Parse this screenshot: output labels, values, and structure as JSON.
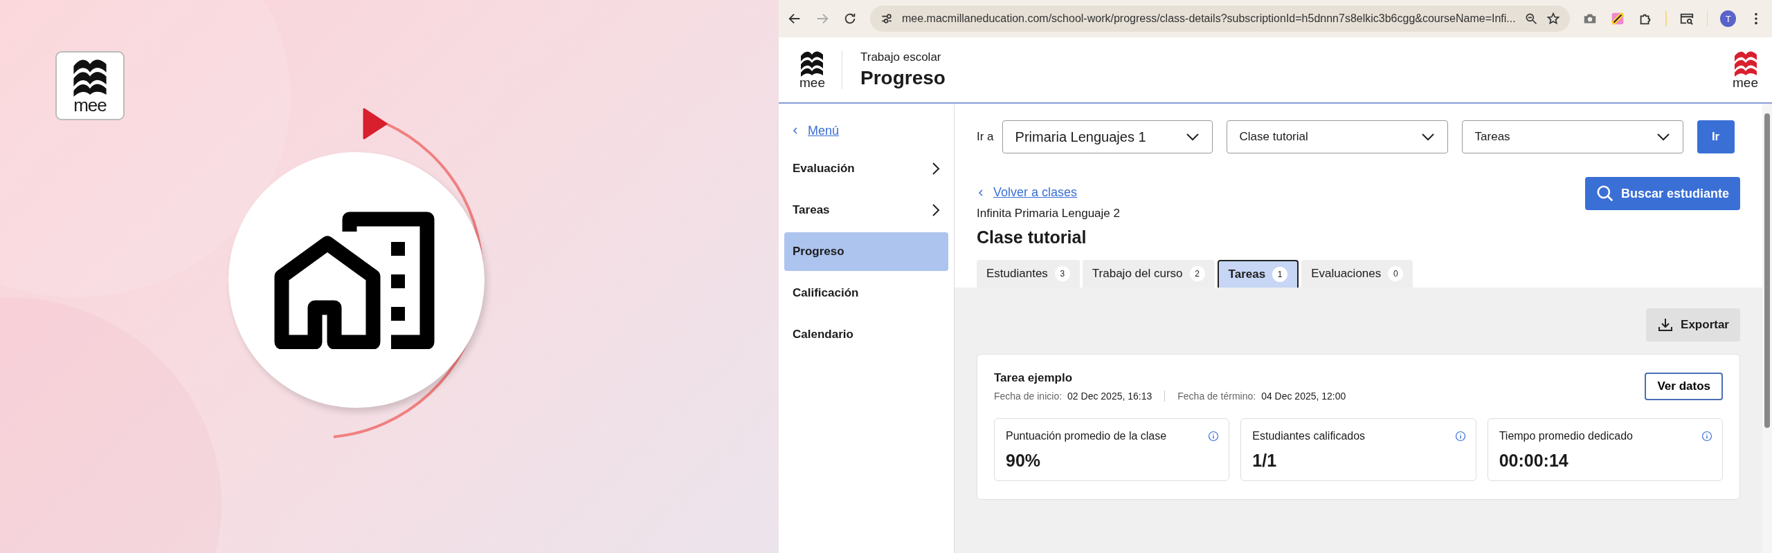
{
  "banner": {
    "logo_text": "mee"
  },
  "browser": {
    "url": "mee.macmillaneducation.com/school-work/progress/class-details?subscriptionId=h5dnnn7s8elkic3b6cgg&courseName=Infi...",
    "avatar": "T"
  },
  "header": {
    "logo_text": "mee",
    "section": "Trabajo escolar",
    "title": "Progreso",
    "brand_logo_text": "mee"
  },
  "sidebar": {
    "back_link": "Menú",
    "items": [
      {
        "label": "Evaluación",
        "kind": "submenu",
        "selected": false
      },
      {
        "label": "Tareas",
        "kind": "submenu",
        "selected": false
      },
      {
        "label": "Progreso",
        "kind": "link",
        "selected": true
      },
      {
        "label": "Calificación",
        "kind": "link",
        "selected": false
      },
      {
        "label": "Calendario",
        "kind": "link",
        "selected": false
      }
    ]
  },
  "navigator": {
    "label": "Ir a",
    "dropdowns": [
      {
        "value": "Primaria Lenguajes 1"
      },
      {
        "value": "Clase tutorial"
      },
      {
        "value": "Tareas"
      }
    ],
    "go_button": "Ir"
  },
  "back_link": "Volver a clases",
  "search_button": "Buscar estudiante",
  "course": "Infinita Primaria Lenguaje 2",
  "class_title": "Clase tutorial",
  "tabs": [
    {
      "label": "Estudiantes",
      "count": "3",
      "selected": false
    },
    {
      "label": "Trabajo del curso",
      "count": "2",
      "selected": false
    },
    {
      "label": "Tareas",
      "count": "1",
      "selected": true
    },
    {
      "label": "Evaluaciones",
      "count": "0",
      "selected": false
    }
  ],
  "export_button": "Exportar",
  "assignment": {
    "title": "Tarea ejemplo",
    "start_label": "Fecha de inicio:",
    "start_value": "02 Dec 2025, 16:13",
    "end_label": "Fecha de término:",
    "end_value": "04 Dec 2025, 12:00",
    "view_button": "Ver datos",
    "stats": [
      {
        "label": "Puntuación promedio de la clase",
        "value": "90%"
      },
      {
        "label": "Estudiantes calificados",
        "value": "1/1"
      },
      {
        "label": "Tiempo promedio dedicado",
        "value": "00:00:14"
      }
    ]
  }
}
